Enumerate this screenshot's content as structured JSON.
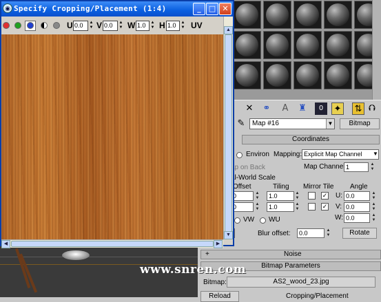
{
  "crop_window": {
    "title": "Specify Cropping/Placement (1:4)",
    "buttons": {
      "minimize": "_",
      "maximize": "□",
      "close": "✕"
    },
    "toolbar": {
      "u_label": "U",
      "u_value": "0.0",
      "v_label": "V",
      "v_value": "0.0",
      "w_label": "W",
      "w_value": "1.0",
      "h_label": "H",
      "h_value": "1.0",
      "uv_label": "UV"
    },
    "channel_colors": [
      "#e03030",
      "#20a020",
      "#2040d0"
    ]
  },
  "material_editor": {
    "map_name": "Map #16",
    "map_type_button": "Bitmap",
    "coordinates": {
      "header": "Coordinates",
      "environ_label": "Environ",
      "mapping_label": "Mapping:",
      "mapping_value": "Explicit Map Channel",
      "map_on_back": "ap on Back",
      "map_channel_label": "Map Channel:",
      "map_channel_value": "1",
      "real_world_scale": "al-World Scale",
      "offset_label": "Offset",
      "tiling_label": "Tiling",
      "mirror_tile_label": "Mirror Tile",
      "angle_label": "Angle",
      "offset_u": "0",
      "offset_v": "0",
      "tiling_u": "1.0",
      "tiling_v": "1.0",
      "mirror_u": "",
      "tile_u": "✓",
      "mirror_v": "",
      "tile_v": "✓",
      "angle_u_label": "U:",
      "angle_u": "0.0",
      "angle_v_label": "V:",
      "angle_v": "0.0",
      "angle_w_label": "W:",
      "angle_w": "0.0",
      "vw_label": "VW",
      "wu_label": "WU",
      "blur_offset_label": "Blur offset:",
      "blur_offset_value": "0.0",
      "rotate_button": "Rotate"
    },
    "noise": {
      "plus": "+",
      "label": "Noise"
    },
    "bitmap_params": {
      "header": "Bitmap Parameters",
      "bitmap_label": "Bitmap:",
      "bitmap_file": "AS2_wood_23.jpg",
      "reload_button": "Reload",
      "cropping_label": "Cropping/Placement"
    }
  },
  "watermark": "www.snren.com"
}
